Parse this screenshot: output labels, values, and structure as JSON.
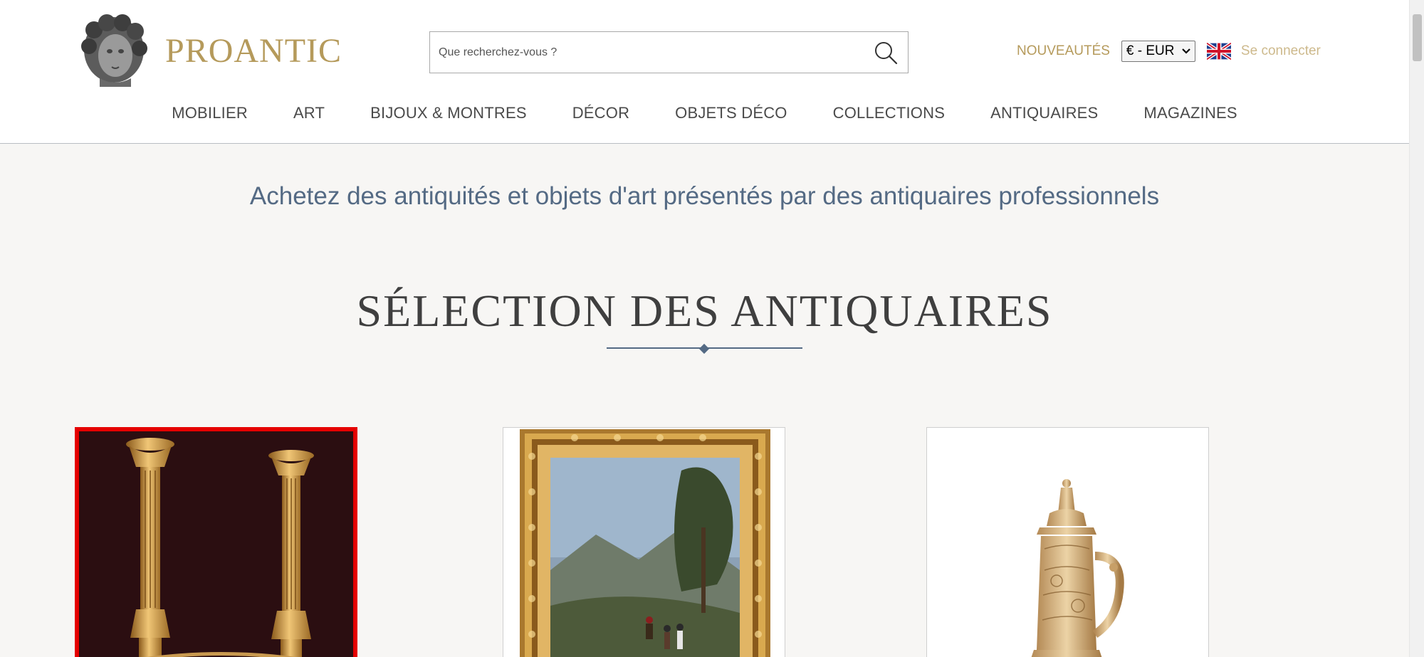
{
  "brand": {
    "name": "PROANTIC"
  },
  "search": {
    "placeholder": "Que recherchez-vous ?"
  },
  "header": {
    "nouveautes_label": "NOUVEAUTÉS",
    "currency_value": "€ - EUR",
    "login_label": "Se connecter"
  },
  "nav": {
    "items": [
      {
        "label": "MOBILIER"
      },
      {
        "label": "ART"
      },
      {
        "label": "BIJOUX & MONTRES"
      },
      {
        "label": "DÉCOR"
      },
      {
        "label": "OBJETS DÉCO"
      },
      {
        "label": "COLLECTIONS"
      },
      {
        "label": "ANTIQUAIRES"
      },
      {
        "label": "MAGAZINES"
      }
    ]
  },
  "main": {
    "tagline": "Achetez des antiquités et objets d'art présentés par des antiquaires professionnels",
    "section_title": "SÉLECTION DES ANTIQUAIRES"
  },
  "icons": {
    "logo": "bust-logo-icon",
    "search": "search-icon",
    "flag": "uk-flag-icon",
    "caret": "chevron-down-icon"
  },
  "colors": {
    "brand_gold": "#b59a5b",
    "nav_text": "#4a4a4a",
    "tagline_blue": "#546a84",
    "selected_card_border": "#e50000"
  }
}
